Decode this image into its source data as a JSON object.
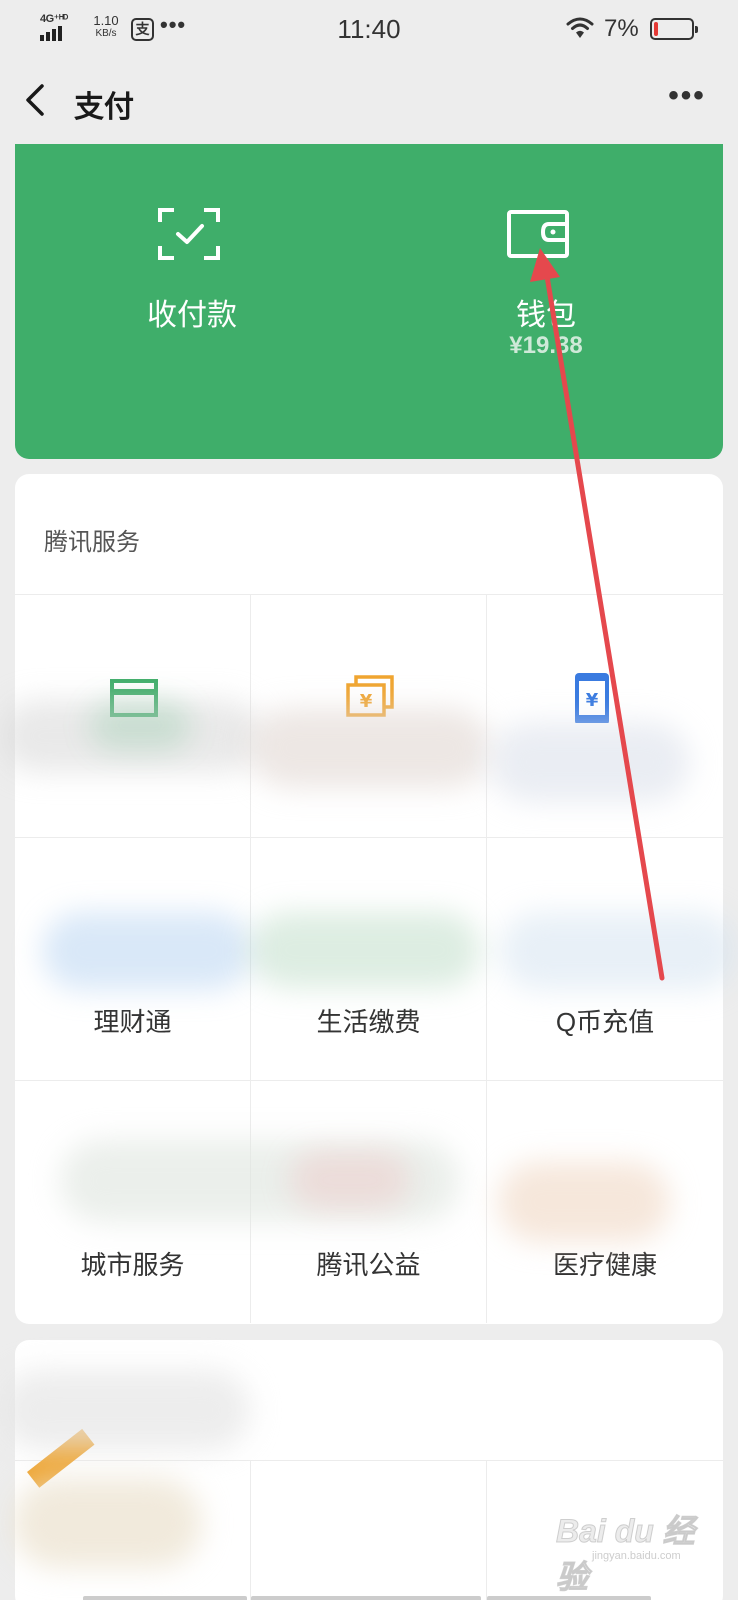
{
  "status_bar": {
    "network": "4G⁺ᴴᴰ",
    "speed_value": "1.10",
    "speed_unit": "KB/s",
    "app_glyph": "支",
    "more": "•••",
    "time": "11:40",
    "battery_percent": "7%",
    "battery_level": 0.07,
    "battery_color": "#e53935"
  },
  "nav": {
    "back_icon": "chevron-left-icon",
    "title": "支付",
    "more": "•••"
  },
  "wallet_card": {
    "background": "#3fae6a",
    "collect_pay": {
      "icon": "scan-check-icon",
      "label": "收付款"
    },
    "wallet": {
      "icon": "wallet-icon",
      "label": "钱包",
      "balance": "¥19.38"
    }
  },
  "tencent_services": {
    "title": "腾讯服务",
    "items": [
      {
        "label": "",
        "icon": "card-icon",
        "color": "#3fae6a"
      },
      {
        "label": "",
        "icon": "cash-icon",
        "color": "#f0a530"
      },
      {
        "label": "",
        "icon": "phone-recharge-icon",
        "color": "#3a7be0"
      },
      {
        "label": "理财通",
        "icon": "",
        "color": "#3a7be0"
      },
      {
        "label": "生活缴费",
        "icon": "",
        "color": "#3fae6a"
      },
      {
        "label": "Q币充值",
        "icon": "",
        "color": "#3a7be0"
      },
      {
        "label": "城市服务",
        "icon": "",
        "color": "#3fae6a"
      },
      {
        "label": "腾讯公益",
        "icon": "",
        "color": "#e86d6d"
      },
      {
        "label": "医疗健康",
        "icon": "",
        "color": "#f0a530"
      }
    ]
  },
  "annotation": {
    "arrow_color": "#e5484d"
  },
  "watermark": {
    "text": "Bai du 经验",
    "sub": "jingyan.baidu.com"
  }
}
